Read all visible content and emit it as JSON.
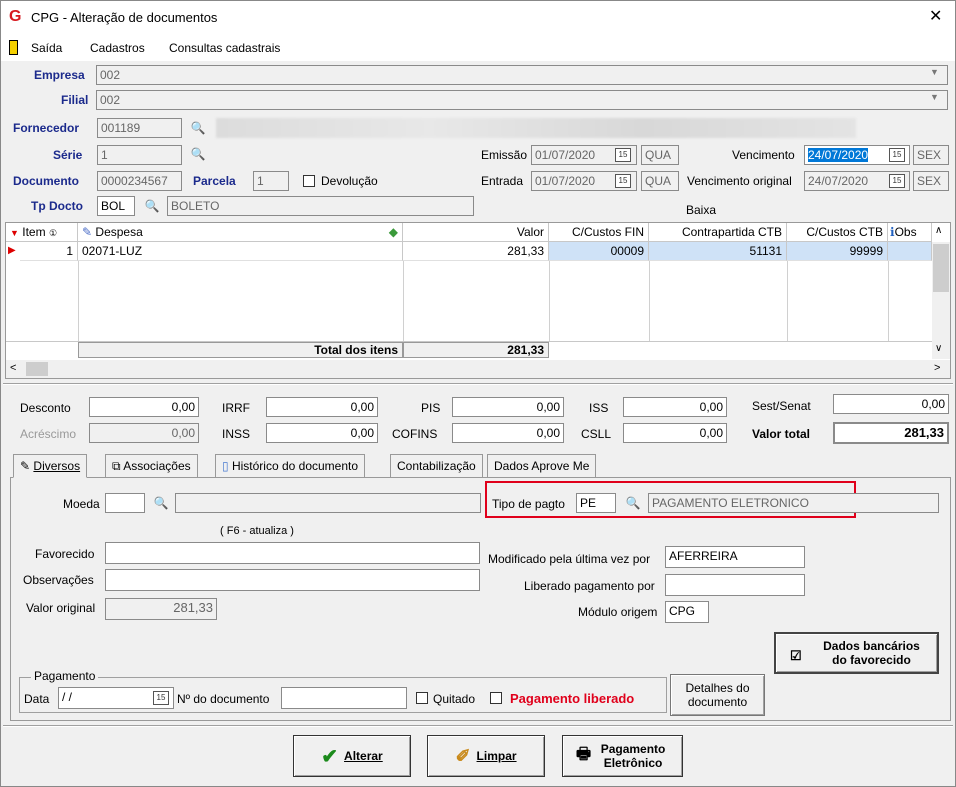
{
  "window": {
    "title": "CPG - Alteração de documentos",
    "close": "✕"
  },
  "menu": [
    "Saída",
    "Cadastros",
    "Consultas cadastrais"
  ],
  "header": {
    "empresa_label": "Empresa",
    "empresa": "002",
    "filial_label": "Filial",
    "filial": "002",
    "fornecedor_label": "Fornecedor",
    "fornecedor": "001189",
    "serie_label": "Série",
    "serie": "1",
    "documento_label": "Documento",
    "documento": "0000234567",
    "parcela_label": "Parcela",
    "parcela": "1",
    "devolucao_label": "Devolução",
    "tpdocto_label": "Tp Docto",
    "tpdocto": "BOL",
    "tpdocto_desc": "BOLETO",
    "emissao_label": "Emissão",
    "emissao": "01/07/2020",
    "emissao_dia": "QUA",
    "entrada_label": "Entrada",
    "entrada": "01/07/2020",
    "entrada_dia": "QUA",
    "vencimento_label": "Vencimento",
    "vencimento": "24/07/2020",
    "vencimento_dia": "SEX",
    "venc_orig_label": "Vencimento original",
    "venc_orig": "24/07/2020",
    "venc_orig_dia": "SEX",
    "baixa_label": "Baixa"
  },
  "grid": {
    "columns": [
      "Item",
      "Despesa",
      "Valor",
      "C/Custos FIN",
      "Contrapartida CTB",
      "C/Custos CTB",
      "Obs"
    ],
    "rows": [
      {
        "item": "1",
        "despesa": "02071-LUZ",
        "valor": "281,33",
        "ccfin": "00009",
        "contrapartida": "51131",
        "ccctb": "99999"
      }
    ],
    "total_label": "Total dos itens",
    "total": "281,33"
  },
  "totals": {
    "desconto_label": "Desconto",
    "desconto": "0,00",
    "acrescimo_label": "Acréscimo",
    "acrescimo": "0,00",
    "irrf_label": "IRRF",
    "irrf": "0,00",
    "inss_label": "INSS",
    "inss": "0,00",
    "pis_label": "PIS",
    "pis": "0,00",
    "cofins_label": "COFINS",
    "cofins": "0,00",
    "iss_label": "ISS",
    "iss": "0,00",
    "csll_label": "CSLL",
    "csll": "0,00",
    "sest_label": "Sest/Senat",
    "sest": "0,00",
    "valor_total_label": "Valor total",
    "valor_total": "281,33"
  },
  "tabs": [
    "Diversos",
    "Associações",
    "Histórico do documento",
    "Contabilização",
    "Dados Aprove Me"
  ],
  "diversos": {
    "moeda_label": "Moeda",
    "moeda": "",
    "f6_label": "( F6 - atualiza )",
    "favorecido_label": "Favorecido",
    "favorecido": "",
    "observacoes_label": "Observações",
    "observacoes": "",
    "valor_original_label": "Valor original",
    "valor_original": "281,33",
    "tipo_pagto_label": "Tipo de pagto",
    "tipo_pagto": "PE",
    "tipo_pagto_desc": "PAGAMENTO ELETRONICO",
    "modificado_label": "Modificado pela última vez por",
    "modificado": "AFERREIRA",
    "liberado_label": "Liberado pagamento por",
    "liberado": "",
    "modulo_label": "Módulo origem",
    "modulo": "CPG",
    "dados_bancarios": "Dados bancários do favorecido",
    "pagamento_group": "Pagamento",
    "data_label": "Data",
    "data": " /  /",
    "ndoc_label": "Nº do documento",
    "ndoc": "",
    "quitado_label": "Quitado",
    "pag_liberado_label": "Pagamento liberado",
    "detalhes_btn": "Detalhes do documento"
  },
  "footer": {
    "alterar": "Alterar",
    "limpar": "Limpar",
    "pagamento": "Pagamento Eletrônico"
  },
  "colors": {
    "accent": "#1b2a8c",
    "highlight": "#0078d7",
    "red": "#e0001b",
    "selected_row": "#cfe2f7"
  }
}
